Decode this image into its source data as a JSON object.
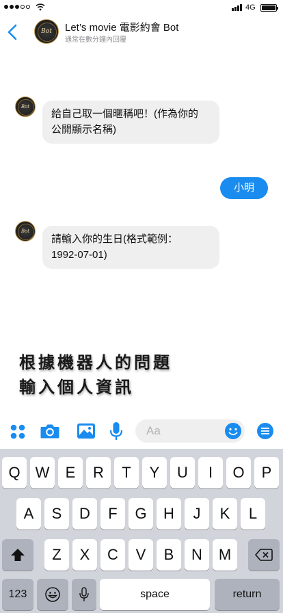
{
  "status_bar": {
    "network": "4G"
  },
  "header": {
    "title": "Let’s movie 電影約會 Bot",
    "subtitle": "通常在數分鐘內回覆",
    "logo_text": "Bot"
  },
  "messages": {
    "bot_1": {
      "line_1": "給自己取一個暱稱吧！(作為你的",
      "line_2": "公開顯示名稱)"
    },
    "user_1": "小明",
    "bot_2": {
      "line_1": "請輸入你的生日(格式範例：",
      "line_2": "1992-07-01)"
    }
  },
  "caption": {
    "line_1": "根據機器人的問題",
    "line_2": "輸入個人資訊"
  },
  "composer": {
    "placeholder": "Aa",
    "tools": [
      "more-dots-icon",
      "camera-icon",
      "photo-icon",
      "microphone-icon",
      "emoji-icon",
      "menu-icon"
    ]
  },
  "keyboard": {
    "row_1": [
      "Q",
      "W",
      "E",
      "R",
      "T",
      "Y",
      "U",
      "I",
      "O",
      "P"
    ],
    "row_2": [
      "A",
      "S",
      "D",
      "F",
      "G",
      "H",
      "J",
      "K",
      "L"
    ],
    "row_3": [
      "Z",
      "X",
      "C",
      "V",
      "B",
      "N",
      "M"
    ],
    "numbers_label": "123",
    "space_label": "space",
    "return_label": "return"
  },
  "colors": {
    "accent": "#1a8cf0",
    "bubble_in": "#efefef",
    "keyboard_bg": "#d1d4da"
  }
}
